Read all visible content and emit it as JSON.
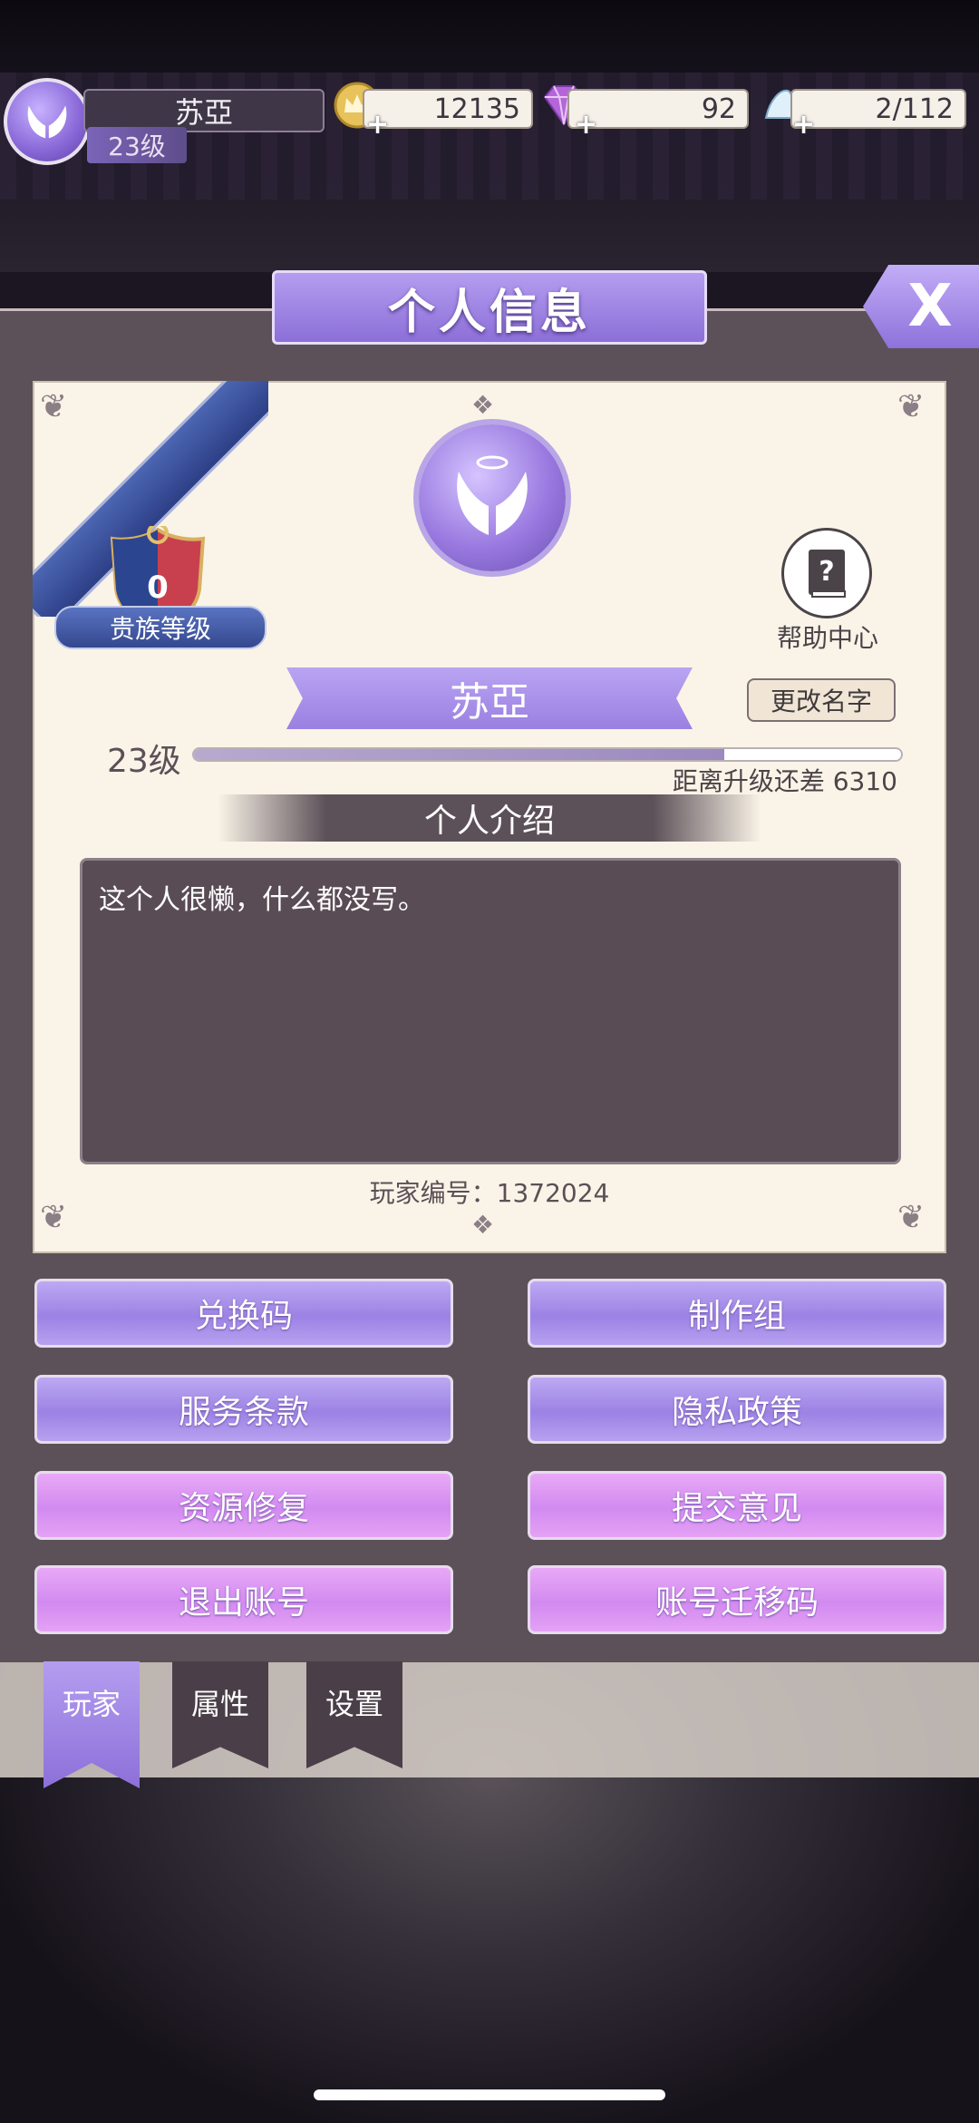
{
  "player": {
    "name": "苏亞",
    "level_badge": "23级"
  },
  "resources": {
    "gold": "12135",
    "gems": "92",
    "stamina": "2/112"
  },
  "panel": {
    "title": "个人信息",
    "close_label": "X"
  },
  "profile": {
    "noble_level_value": "0",
    "noble_level_label": "贵族等级",
    "help_label": "帮助中心",
    "display_name": "苏亞",
    "rename_label": "更改名字",
    "level_text": "23级",
    "xp_progress": 0.75,
    "xp_remaining_text": "距离升级还差 6310",
    "intro_header": "个人介绍",
    "intro_text": "这个人很懒，什么都没写。",
    "player_id_text": "玩家编号：1372024"
  },
  "buttons": {
    "redeem": "兑换码",
    "credits": "制作组",
    "terms": "服务条款",
    "privacy": "隐私政策",
    "repair": "资源修复",
    "feedback": "提交意见",
    "logout": "退出账号",
    "migration": "账号迁移码"
  },
  "tabs": {
    "player": "玩家",
    "attributes": "属性",
    "settings": "设置"
  },
  "colors": {
    "accent_purple": "#9c82e4",
    "accent_pink": "#d28af0",
    "card_bg": "#faf4e8",
    "panel_bg": "#5c5158"
  }
}
